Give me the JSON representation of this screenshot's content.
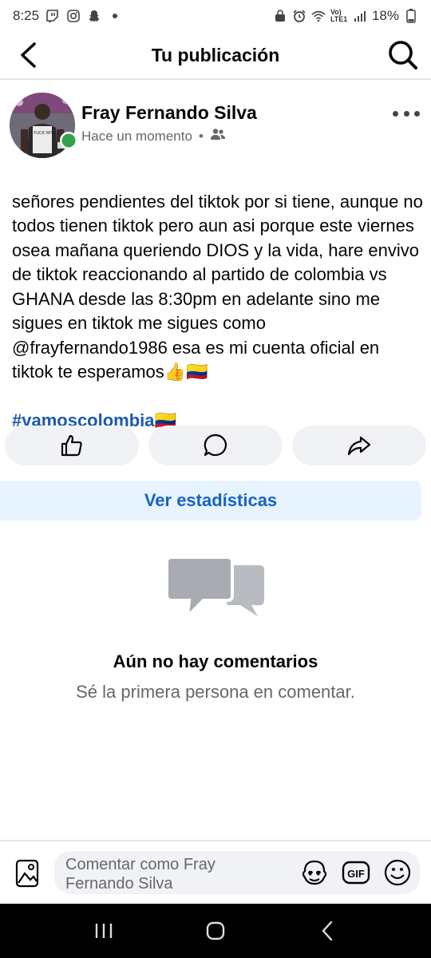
{
  "status_bar": {
    "time": "8:25",
    "battery": "18%",
    "network_label": "Vo) LTE1",
    "left_icons": [
      "twitch-icon",
      "instagram-icon",
      "snapchat-icon",
      "dot-icon"
    ],
    "right_icons": [
      "lock-icon",
      "alarm-icon",
      "wifi-icon",
      "signal-icon",
      "battery-icon"
    ]
  },
  "header": {
    "title": "Tu publicación"
  },
  "post": {
    "author": "Fray Fernando Silva",
    "time": "Hace un momento",
    "separator": "•",
    "audience_icon": "friends-icon",
    "text": "señores pendientes del tiktok por si tiene, aunque no todos tienen tiktok pero aun asi porque este viernes osea mañana queriendo DIOS y la vida, hare envivo de tiktok reaccionando al partido de colombia vs GHANA  desde las 8:30pm en adelante sino me sigues en tiktok me sigues como @frayfernando1986 esa es mi cuenta oficial en tiktok te esperamos👍🇨🇴",
    "hashtag": "#vamoscolombia🇨🇴",
    "avatar_tshirt_text": "DON'T FUCK WITH TIM"
  },
  "actions": {
    "icons": [
      "like-icon",
      "comment-icon",
      "share-icon"
    ]
  },
  "stats_button": "Ver estadísticas",
  "empty_state": {
    "title": "Aún no hay comentarios",
    "subtitle": "Sé la primera persona en comentar."
  },
  "comment_bar": {
    "placeholder": "Comentar como Fray Fernando Silva",
    "gif_label": "GIF",
    "icons": [
      "photo-icon",
      "avatar-sticker-icon",
      "gif-icon",
      "emoji-icon"
    ]
  },
  "colors": {
    "accent": "#1664c0",
    "hashtag": "#1b59b0",
    "online": "#31a24c",
    "light_button": "#f0f2f5",
    "stats_bg": "#e7f3ff"
  }
}
